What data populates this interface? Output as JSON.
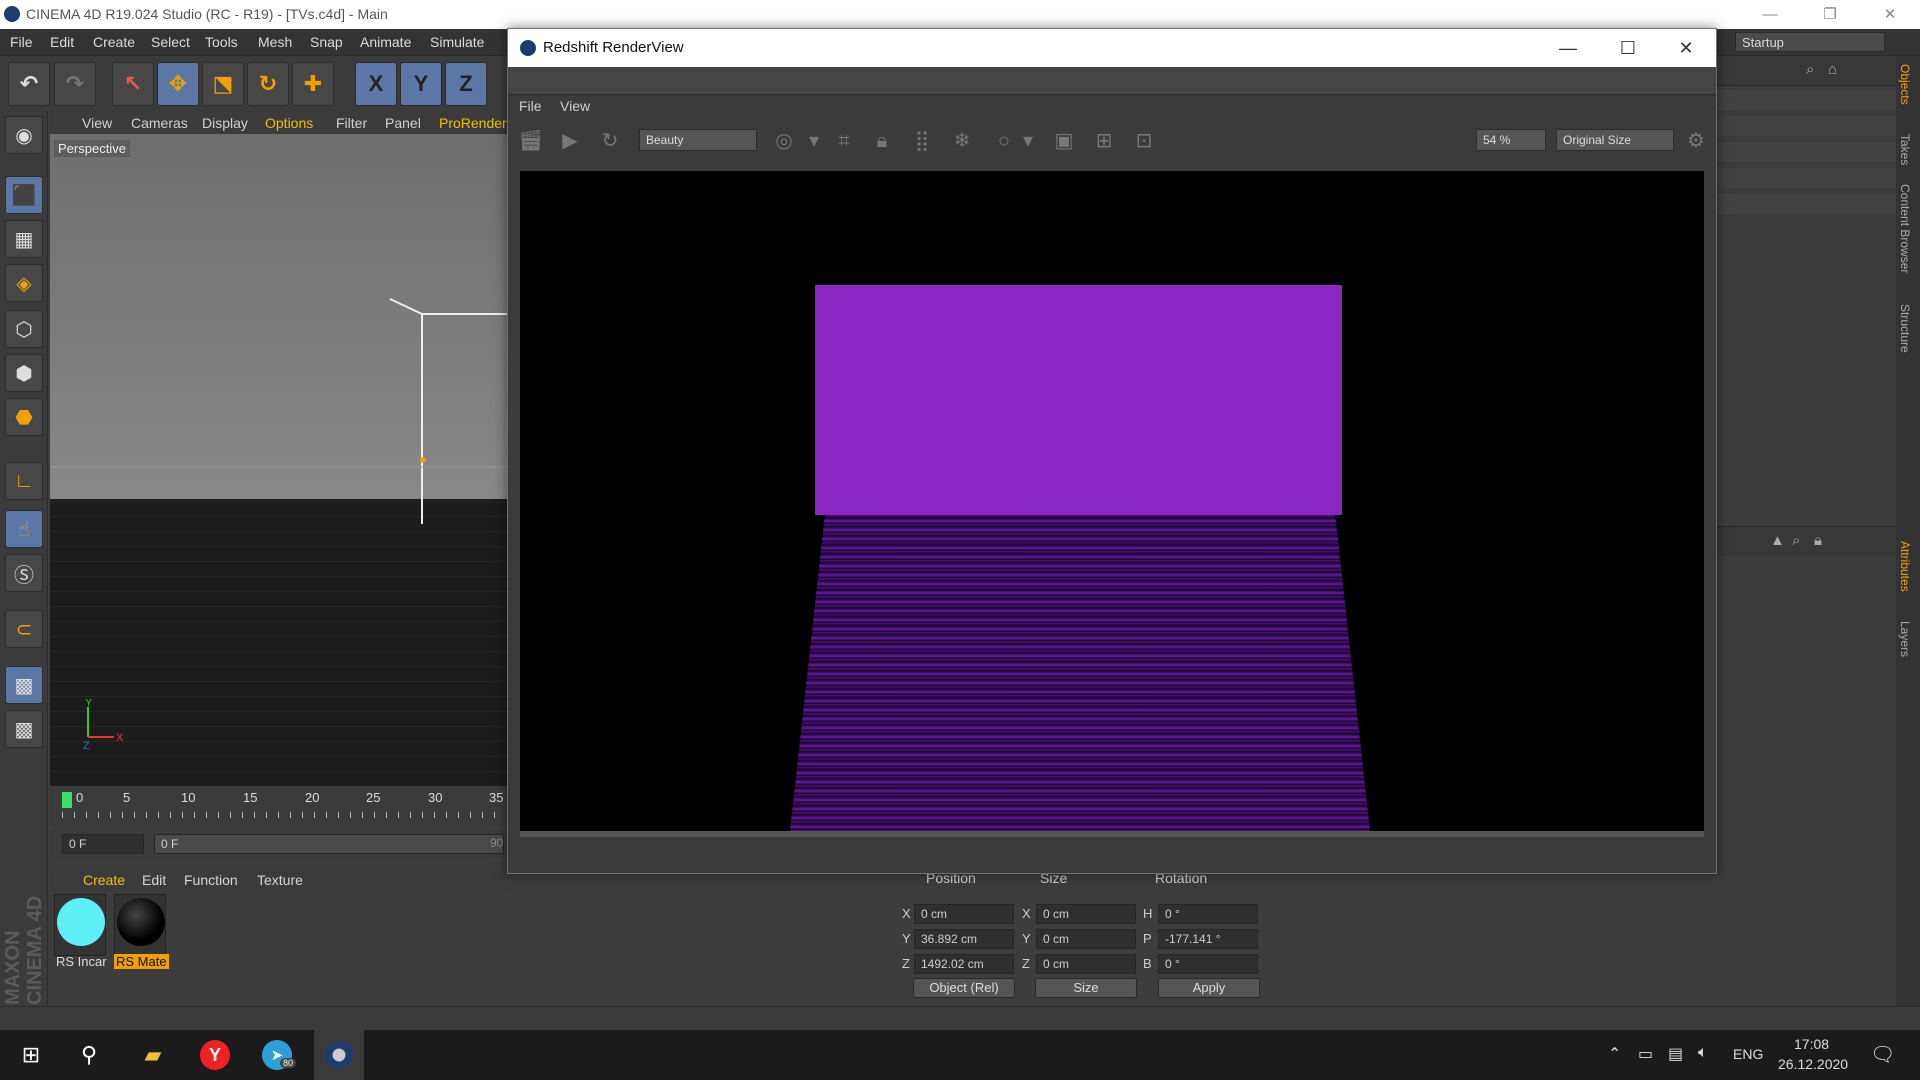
{
  "c4d": {
    "window_title": "CINEMA 4D R19.024 Studio (RC - R19) - [TVs.c4d] - Main",
    "menu": [
      "File",
      "Edit",
      "Create",
      "Select",
      "Tools",
      "Mesh",
      "Snap",
      "Animate",
      "Simulate"
    ],
    "layout_label": "Startup",
    "toolbar_axes": [
      "X",
      "Y",
      "Z"
    ],
    "viewport_menu": [
      "View",
      "Cameras",
      "Display",
      "Options",
      "Filter",
      "Panel",
      "ProRender"
    ],
    "viewport_label": "Perspective",
    "axis_labels": {
      "x": "X",
      "y": "Y",
      "z": "Z"
    },
    "timeline_ticks": [
      "0",
      "5",
      "10",
      "15",
      "20",
      "25",
      "30",
      "35"
    ],
    "frame_field": "0 F",
    "frame_slider": "0 F",
    "frame_end": "90",
    "material_menu": [
      "Create",
      "Edit",
      "Function",
      "Texture"
    ],
    "materials": [
      {
        "name": "RS Incar",
        "color": "#5ef0f5"
      },
      {
        "name": "RS Mate",
        "color": "#0a0a0a"
      }
    ],
    "coords": {
      "headers": [
        "Position",
        "Size",
        "Rotation"
      ],
      "rows": [
        {
          "axis": "X",
          "position": "0 cm",
          "size_axis": "X",
          "size": "0 cm",
          "rot_axis": "H",
          "rotation": "0 °"
        },
        {
          "axis": "Y",
          "position": "36.892 cm",
          "size_axis": "Y",
          "size": "0 cm",
          "rot_axis": "P",
          "rotation": "-177.141 °"
        },
        {
          "axis": "Z",
          "position": "1492.02 cm",
          "size_axis": "Z",
          "size": "0 cm",
          "rot_axis": "B",
          "rotation": "0 °"
        }
      ],
      "mode": "Object (Rel)",
      "size_mode": "Size",
      "apply": "Apply"
    },
    "right_tabs": [
      "Objects",
      "Takes",
      "Content Browser",
      "Structure",
      "Attributes",
      "Layers"
    ],
    "brand": "MAXON CINEMA 4D"
  },
  "redshift": {
    "title": "Redshift RenderView",
    "menu": [
      "File",
      "View"
    ],
    "aov": "Beauty",
    "zoom": "54 %",
    "size_mode": "Original Size",
    "render_colors": {
      "screen": "#8a26c2",
      "background": "#000000"
    }
  },
  "taskbar": {
    "language": "ENG",
    "time": "17:08",
    "date": "26.12.2020",
    "telegram_badge": "80"
  }
}
